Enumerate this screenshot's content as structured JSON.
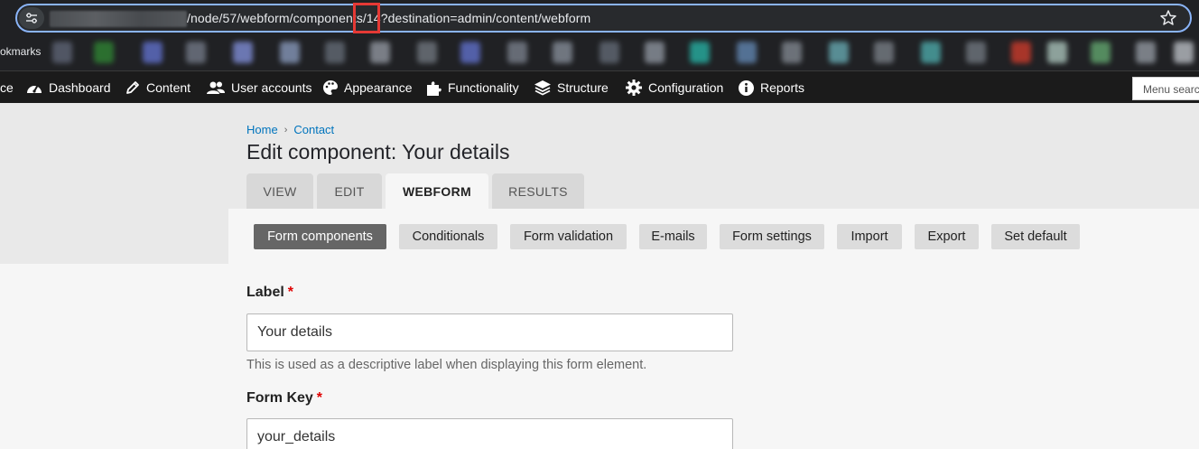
{
  "browser": {
    "url": "/node/57/webform/components/14?destination=admin/content/webform",
    "bookmarks_label": "okmarks"
  },
  "toolbar": {
    "items": [
      {
        "label": "ce",
        "icon": "site-icon"
      },
      {
        "label": "Dashboard",
        "icon": "dashboard-icon"
      },
      {
        "label": "Content",
        "icon": "pencil-icon"
      },
      {
        "label": "User accounts",
        "icon": "users-icon"
      },
      {
        "label": "Appearance",
        "icon": "palette-icon"
      },
      {
        "label": "Functionality",
        "icon": "puzzle-icon"
      },
      {
        "label": "Structure",
        "icon": "layers-icon"
      },
      {
        "label": "Configuration",
        "icon": "gear-icon"
      },
      {
        "label": "Reports",
        "icon": "info-icon"
      }
    ],
    "menu_search": "Menu search"
  },
  "breadcrumb": {
    "home": "Home",
    "contact": "Contact"
  },
  "page_title": "Edit component: Your details",
  "tabs": [
    {
      "label": "VIEW",
      "active": false
    },
    {
      "label": "EDIT",
      "active": false
    },
    {
      "label": "WEBFORM",
      "active": true
    },
    {
      "label": "RESULTS",
      "active": false
    }
  ],
  "subtabs": [
    {
      "label": "Form components",
      "active": true
    },
    {
      "label": "Conditionals",
      "active": false
    },
    {
      "label": "Form validation",
      "active": false
    },
    {
      "label": "E-mails",
      "active": false
    },
    {
      "label": "Form settings",
      "active": false
    },
    {
      "label": "Import",
      "active": false
    },
    {
      "label": "Export",
      "active": false
    },
    {
      "label": "Set default",
      "active": false
    }
  ],
  "form": {
    "label_field": {
      "label": "Label",
      "required_mark": "*",
      "value": "Your details",
      "description": "This is used as a descriptive label when displaying this form element."
    },
    "key_field": {
      "label": "Form Key",
      "required_mark": "*",
      "value": "your_details"
    }
  },
  "colors": {
    "link": "#0074bd",
    "required": "#e00000",
    "toolbar_bg": "#1b1b1b",
    "active_subtab": "#666666",
    "url_highlight": "#e53935"
  }
}
